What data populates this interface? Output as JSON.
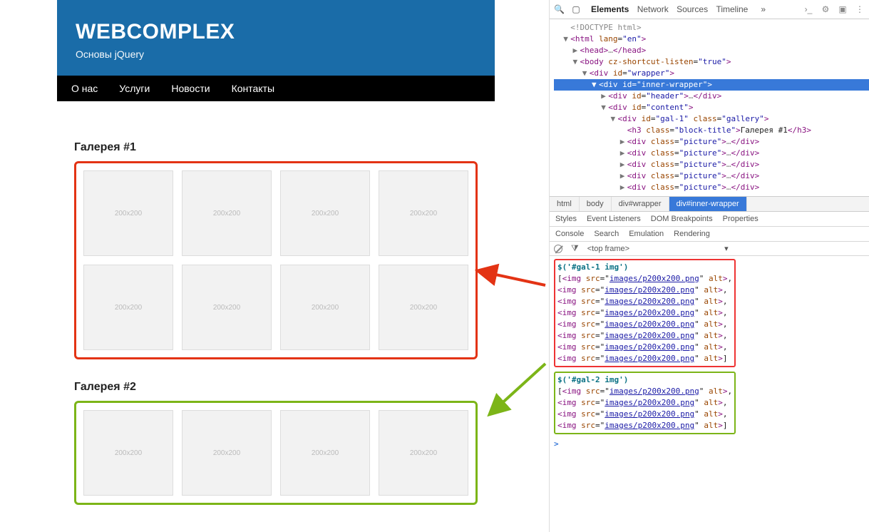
{
  "page": {
    "title": "WEBCOMPLEX",
    "subtitle": "Основы jQuery",
    "accent": "#1a6ca8",
    "nav": [
      "О нас",
      "Услуги",
      "Новости",
      "Контакты"
    ],
    "galleries": [
      {
        "title": "Галерея #1",
        "border": "#e33314",
        "count": 8,
        "placeholder": "200x200"
      },
      {
        "title": "Галерея #2",
        "border": "#7cb518",
        "count": 4,
        "placeholder": "200x200"
      }
    ]
  },
  "devtools": {
    "toolbar_tabs": [
      "Elements",
      "Network",
      "Sources",
      "Timeline"
    ],
    "toolbar_selected": "Elements",
    "toolbar_overflow": "»",
    "dom": [
      {
        "depth": 0,
        "exp": "",
        "html": "<!DOCTYPE html>",
        "gray": true
      },
      {
        "depth": 0,
        "exp": "▼",
        "open": {
          "name": "html",
          "attrs": [
            [
              "lang",
              "en"
            ]
          ]
        }
      },
      {
        "depth": 1,
        "exp": "▶",
        "open": {
          "name": "head"
        },
        "ell": true,
        "close": "head"
      },
      {
        "depth": 1,
        "exp": "▼",
        "open": {
          "name": "body",
          "attrs": [
            [
              "cz-shortcut-listen",
              "true"
            ]
          ]
        }
      },
      {
        "depth": 2,
        "exp": "▼",
        "open": {
          "name": "div",
          "attrs": [
            [
              "id",
              "wrapper"
            ]
          ]
        }
      },
      {
        "depth": 3,
        "exp": "▼",
        "open": {
          "name": "div",
          "attrs": [
            [
              "id",
              "inner-wrapper"
            ]
          ]
        },
        "selected": true
      },
      {
        "depth": 4,
        "exp": "▶",
        "open": {
          "name": "div",
          "attrs": [
            [
              "id",
              "header"
            ]
          ]
        },
        "ell": true,
        "close": "div"
      },
      {
        "depth": 4,
        "exp": "▼",
        "open": {
          "name": "div",
          "attrs": [
            [
              "id",
              "content"
            ]
          ]
        }
      },
      {
        "depth": 5,
        "exp": "▼",
        "open": {
          "name": "div",
          "attrs": [
            [
              "id",
              "gal-1"
            ],
            [
              "class",
              "gallery"
            ]
          ]
        }
      },
      {
        "depth": 6,
        "exp": "",
        "open": {
          "name": "h3",
          "attrs": [
            [
              "class",
              "block-title"
            ]
          ]
        },
        "text": "Галерея #1",
        "close": "h3"
      },
      {
        "depth": 6,
        "exp": "▶",
        "open": {
          "name": "div",
          "attrs": [
            [
              "class",
              "picture"
            ]
          ]
        },
        "ell": true,
        "close": "div"
      },
      {
        "depth": 6,
        "exp": "▶",
        "open": {
          "name": "div",
          "attrs": [
            [
              "class",
              "picture"
            ]
          ]
        },
        "ell": true,
        "close": "div"
      },
      {
        "depth": 6,
        "exp": "▶",
        "open": {
          "name": "div",
          "attrs": [
            [
              "class",
              "picture"
            ]
          ]
        },
        "ell": true,
        "close": "div"
      },
      {
        "depth": 6,
        "exp": "▶",
        "open": {
          "name": "div",
          "attrs": [
            [
              "class",
              "picture"
            ]
          ]
        },
        "ell": true,
        "close": "div"
      },
      {
        "depth": 6,
        "exp": "▶",
        "open": {
          "name": "div",
          "attrs": [
            [
              "class",
              "picture"
            ]
          ]
        },
        "ell": true,
        "close": "div"
      }
    ],
    "crumbs": [
      "html",
      "body",
      "div#wrapper",
      "div#inner-wrapper"
    ],
    "crumb_selected": 3,
    "styles_tabs": [
      "Styles",
      "Event Listeners",
      "DOM Breakpoints",
      "Properties"
    ],
    "console_tabs": [
      "Console",
      "Search",
      "Emulation",
      "Rendering"
    ],
    "console_frame": "<top frame>",
    "console_frame_caret": "▾",
    "console": [
      {
        "group": "red",
        "query": "$('#gal-1 img')",
        "count": 8,
        "src": "images/p200x200.png"
      },
      {
        "group": "green",
        "query": "$('#gal-2 img')",
        "count": 4,
        "src": "images/p200x200.png"
      }
    ]
  }
}
